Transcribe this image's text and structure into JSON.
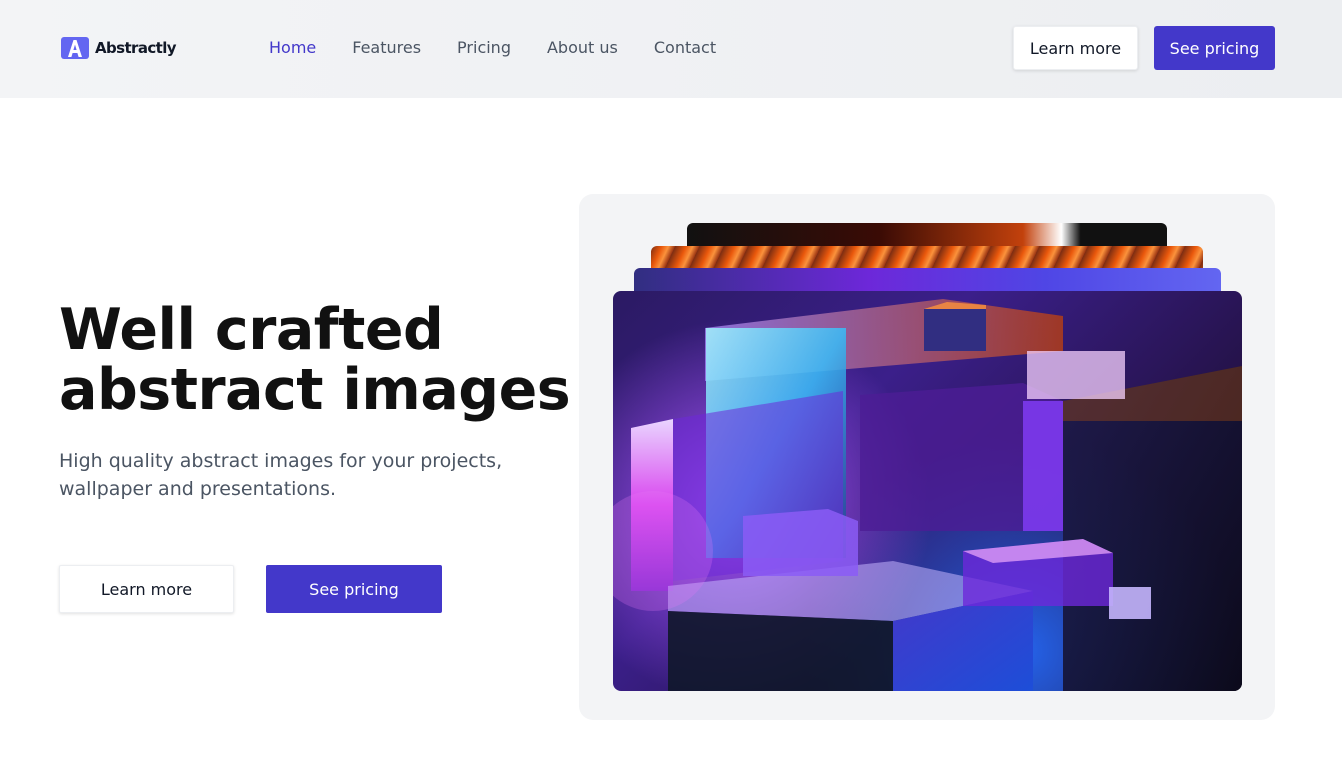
{
  "brand": {
    "name": "Abstractly",
    "logo_icon": "abstractly-logo-icon",
    "color": "#4338ca"
  },
  "nav": {
    "items": [
      {
        "label": "Home",
        "active": true
      },
      {
        "label": "Features",
        "active": false
      },
      {
        "label": "Pricing",
        "active": false
      },
      {
        "label": "About us",
        "active": false
      },
      {
        "label": "Contact",
        "active": false
      }
    ]
  },
  "header_actions": {
    "learn_more": "Learn more",
    "see_pricing": "See pricing"
  },
  "hero": {
    "title_line1": "Well crafted",
    "title_line2": "abstract images",
    "subtitle": "High quality abstract images for your projects, wallpaper and presentations.",
    "learn_more": "Learn more",
    "see_pricing": "See pricing"
  },
  "colors": {
    "accent": "#4338ca",
    "nav_text": "#4b5563",
    "heading": "#111111"
  }
}
